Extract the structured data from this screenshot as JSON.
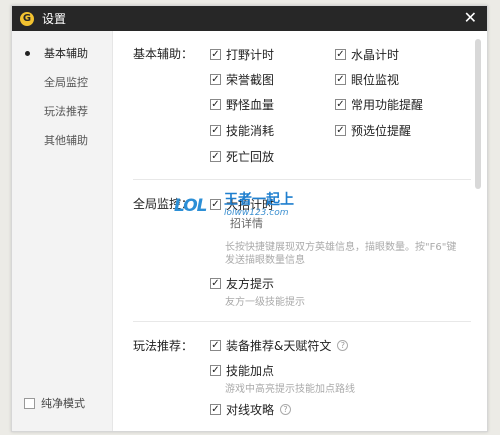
{
  "window": {
    "title": "设置",
    "logo_glyph": "G",
    "close_glyph": "✕"
  },
  "sidebar": {
    "items": [
      {
        "label": "基本辅助"
      },
      {
        "label": "全局监控"
      },
      {
        "label": "玩法推荐"
      },
      {
        "label": "其他辅助"
      }
    ],
    "pure_mode_label": "纯净模式"
  },
  "basic": {
    "title": "基本辅助：",
    "options": [
      {
        "label": "打野计时",
        "checked": true
      },
      {
        "label": "水晶计时",
        "checked": true
      },
      {
        "label": "荣誉截图",
        "checked": true
      },
      {
        "label": "眼位监视",
        "checked": true
      },
      {
        "label": "野怪血量",
        "checked": true
      },
      {
        "label": "常用功能提醒",
        "checked": true
      },
      {
        "label": "技能消耗",
        "checked": true
      },
      {
        "label": "预选位提醒",
        "checked": true
      },
      {
        "label": "死亡回放",
        "checked": true
      }
    ]
  },
  "global": {
    "title": "全局监控：",
    "option1": "大招计时",
    "option1_sub": "招详情",
    "hint1": "长按快捷键展现双方英雄信息，描眼数量。按\"F6\"键",
    "hint1b": "发送描眼数量信息",
    "option2": "友方提示",
    "hint2": "友方一级技能提示"
  },
  "gameplay": {
    "title": "玩法推荐：",
    "option1": "装备推荐&天赋符文",
    "option2": "技能加点",
    "hint2": "游戏中高亮提示技能加点路线",
    "option3": "对线攻略",
    "help_glyph": "?"
  },
  "watermark": {
    "brand": "LOL",
    "text": "王者一起上",
    "url": "lolww123.com"
  },
  "colors": {
    "titlebar": "#272727",
    "logo": "#f2c230",
    "watermark": "#2c8fd6"
  }
}
